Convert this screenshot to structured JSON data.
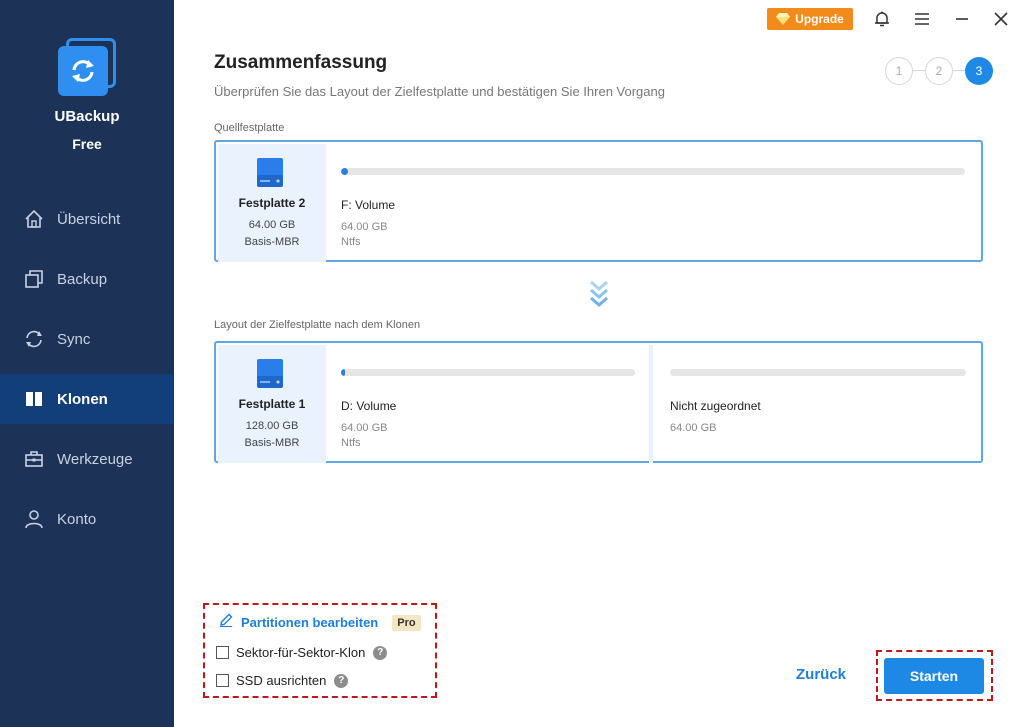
{
  "app": {
    "name": "UBackup",
    "edition": "Free"
  },
  "nav": [
    {
      "label": "Übersicht",
      "icon": "home-icon"
    },
    {
      "label": "Backup",
      "icon": "backup-icon"
    },
    {
      "label": "Sync",
      "icon": "sync-icon"
    },
    {
      "label": "Klonen",
      "icon": "clone-icon",
      "active": true
    },
    {
      "label": "Werkzeuge",
      "icon": "toolbox-icon"
    },
    {
      "label": "Konto",
      "icon": "user-icon"
    }
  ],
  "titlebar": {
    "upgrade_label": "Upgrade",
    "icons": [
      "bell-icon",
      "menu-icon",
      "minimize-icon",
      "close-icon"
    ]
  },
  "page": {
    "title": "Zusammenfassung",
    "subtitle": "Überprüfen Sie das Layout der Zielfestplatte und bestätigen Sie Ihren Vorgang"
  },
  "steps": [
    "1",
    "2",
    "3"
  ],
  "active_step": 3,
  "source": {
    "section_label": "Quellfestplatte",
    "disk": {
      "name": "Festplatte 2",
      "size": "64.00 GB",
      "type": "Basis-MBR"
    },
    "partitions": [
      {
        "name": "F: Volume",
        "size": "64.00 GB",
        "fs": "Ntfs",
        "used": 0.01
      }
    ]
  },
  "target": {
    "section_label": "Layout der Zielfestplatte nach dem Klonen",
    "disk": {
      "name": "Festplatte 1",
      "size": "128.00 GB",
      "type": "Basis-MBR"
    },
    "partitions": [
      {
        "name": "D: Volume",
        "size": "64.00 GB",
        "fs": "Ntfs",
        "used": 0.01
      },
      {
        "name": "Nicht zugeordnet",
        "size": "64.00 GB",
        "fs": "",
        "used": 0
      }
    ]
  },
  "options": {
    "edit_label": "Partitionen bearbeiten",
    "pro_badge": "Pro",
    "sector_label": "Sektor-für-Sektor-Klon",
    "ssd_label": "SSD ausrichten",
    "help_glyph": "?"
  },
  "actions": {
    "back_label": "Zurück",
    "start_label": "Starten"
  },
  "colors": {
    "sidebar": "#1c3257",
    "sidebar_active": "#123f7a",
    "accent": "#1e88e5",
    "upgrade": "#f28b19",
    "highlight_dash": "#c01818"
  }
}
